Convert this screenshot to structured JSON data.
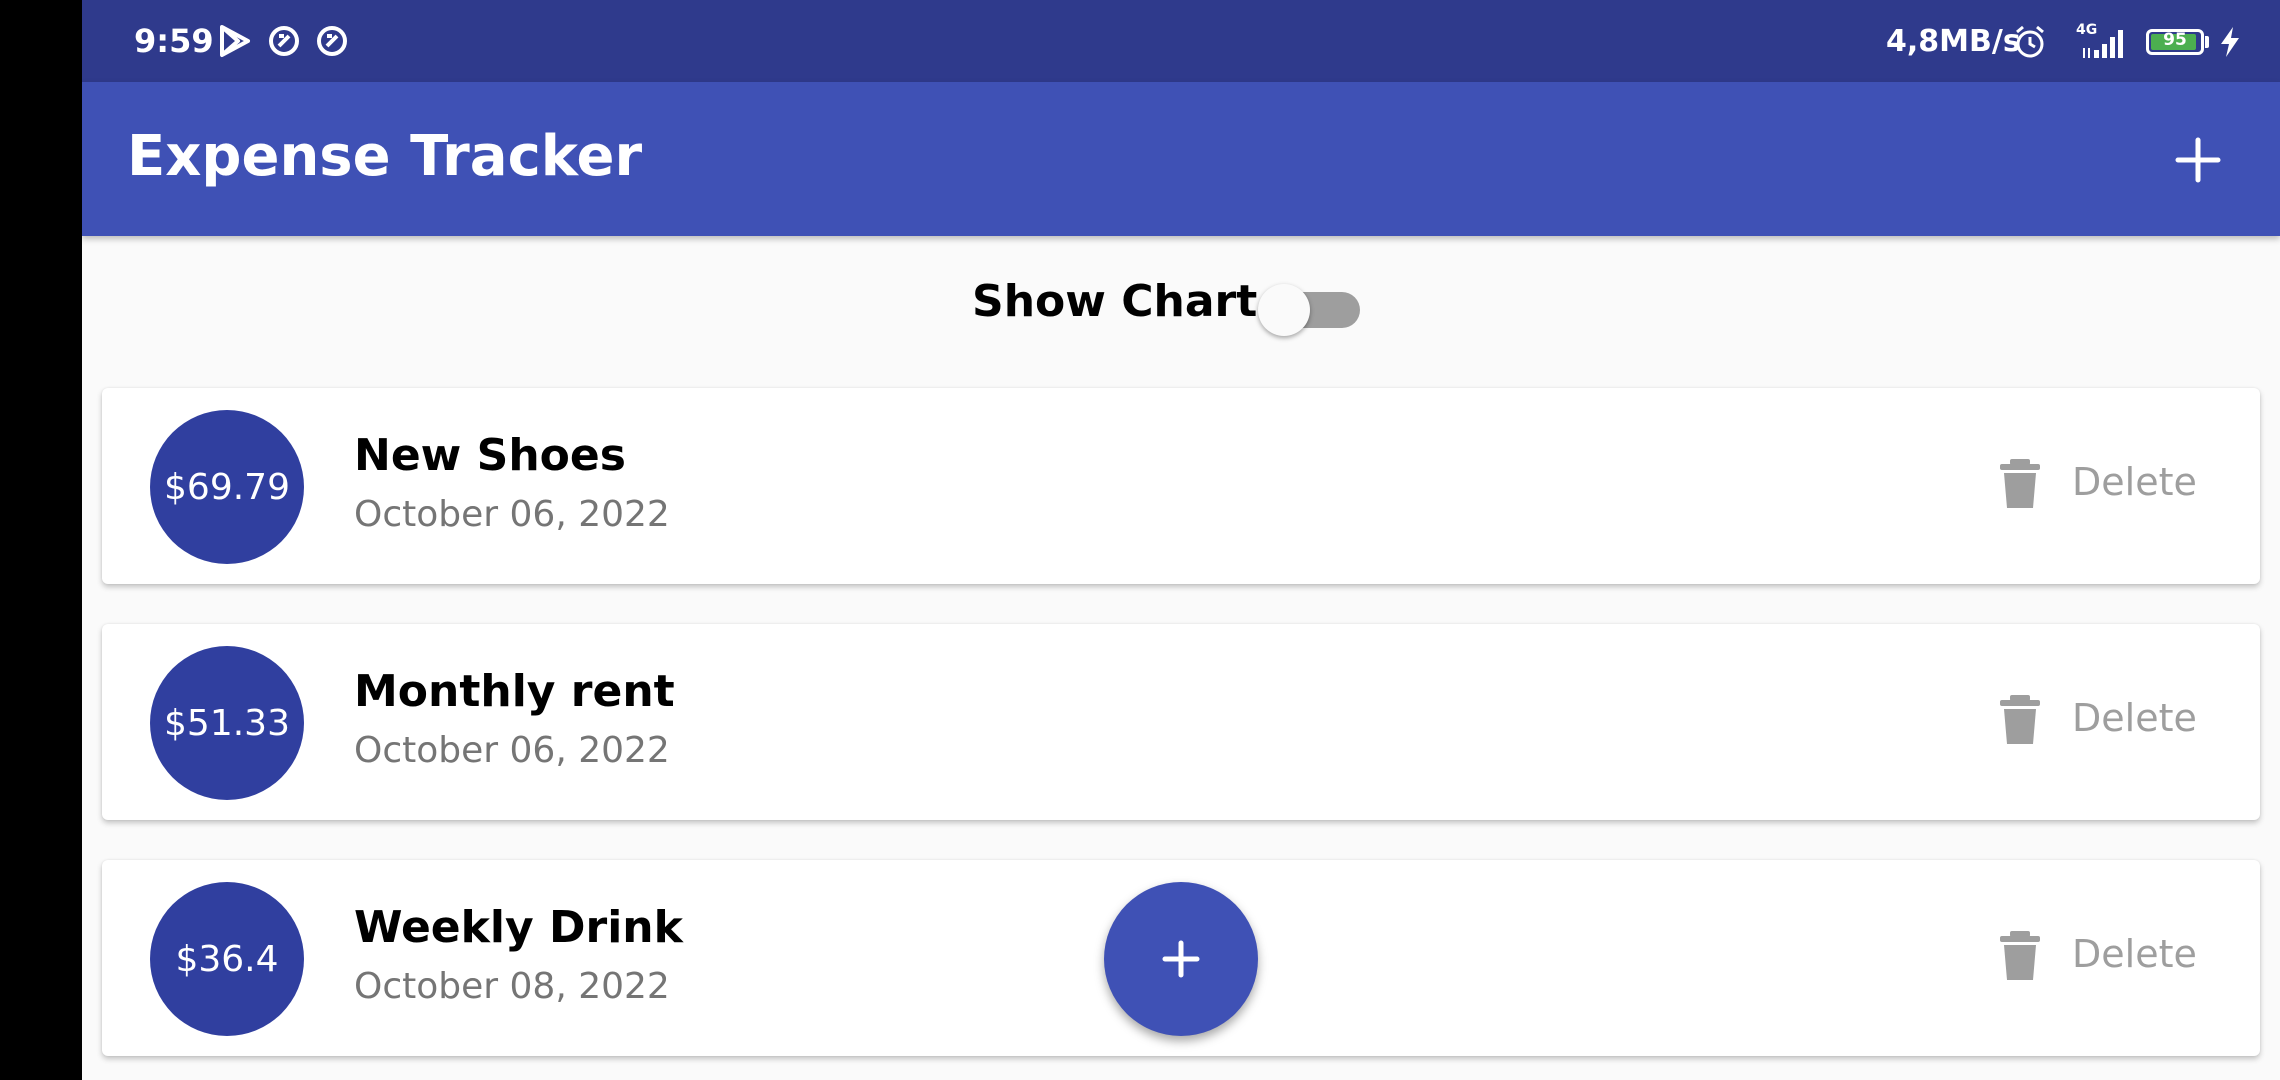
{
  "status_bar": {
    "time": "9:59",
    "network_speed": "4,8MB/s",
    "network_type": "4G",
    "battery_level": "95",
    "battery_fraction": 0.95,
    "notification_icons": [
      "play-store-icon",
      "vpn-icon",
      "vpn-icon"
    ]
  },
  "app_bar": {
    "title": "Expense Tracker",
    "add_icon": "plus-icon"
  },
  "chart_toggle": {
    "label": "Show Chart",
    "on": false
  },
  "transactions": [
    {
      "amount": "$69.79",
      "title": "New Shoes",
      "date": "October 06, 2022",
      "delete_label": "Delete"
    },
    {
      "amount": "$51.33",
      "title": "Monthly rent",
      "date": "October 06, 2022",
      "delete_label": "Delete"
    },
    {
      "amount": "$36.4",
      "title": "Weekly Drink",
      "date": "October 08, 2022",
      "delete_label": "Delete"
    }
  ],
  "fab": {
    "icon": "plus-icon"
  },
  "colors": {
    "primary": "#3f51b5",
    "primary_dark": "#303f9f",
    "status_bar": "#2f3a8c",
    "delete_grey": "#9e9e9e"
  }
}
